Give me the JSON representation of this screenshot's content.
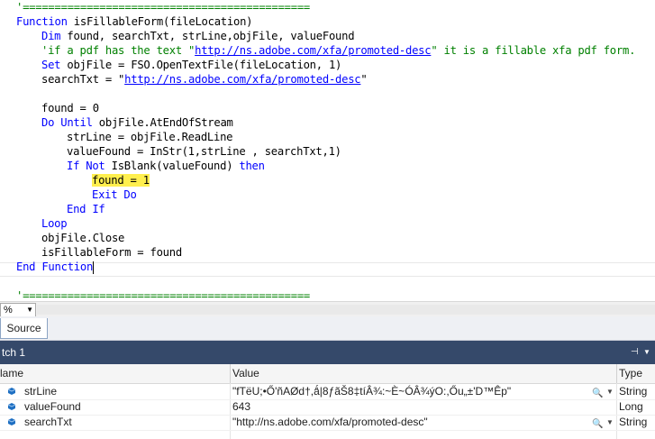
{
  "code": {
    "line1": "'=============================================",
    "line2_kw": "Function",
    "line2_rest": " isFillableForm(fileLocation)",
    "line3_kw": "Dim",
    "line3_rest": " found, searchTxt, strLine,objFile, valueFound",
    "line4_a": "'if a pdf has the text \"",
    "line4_link": "http://ns.adobe.com/xfa/promoted-desc",
    "line4_b": "\" it is a fillable xfa pdf form.",
    "line5_kw": "Set",
    "line5_rest": " objFile = FSO.OpenTextFile(fileLocation, 1)",
    "line6_a": "searchTxt = \"",
    "line6_link": "http://ns.adobe.com/xfa/promoted-desc",
    "line6_b": "\"",
    "line8": "found = 0",
    "line9_kw": "Do Until",
    "line9_rest": " objFile.AtEndOfStream",
    "line10": "strLine = objFile.ReadLine",
    "line11": "valueFound = InStr(1,strLine , searchTxt,1)",
    "line12_kw1": "If Not",
    "line12_mid": " IsBlank(valueFound) ",
    "line12_kw2": "then",
    "line13": "found = 1",
    "line14": "Exit Do",
    "line15": "End If",
    "line16": "Loop",
    "line17": "objFile.Close",
    "line18": "isFillableForm = found",
    "line19": "End Function",
    "line21": "'============================================="
  },
  "editor": {
    "zoom": "%"
  },
  "tabs": {
    "source": "Source"
  },
  "watch": {
    "title": "tch 1",
    "headers": {
      "name": "lame",
      "value": "Value",
      "type": "Type"
    },
    "rows": [
      {
        "name": "strLine",
        "value": "\"fTëU;•Ő'ñAØd†,ǻ|8ƒãŠ8‡tíÂ¾:~È~ÓÂ¾ýO:,Őu„±'D™Êp\"",
        "type": "String"
      },
      {
        "name": "valueFound",
        "value": "643",
        "type": "Long"
      },
      {
        "name": "searchTxt",
        "value": "\"http://ns.adobe.com/xfa/promoted-desc\"",
        "type": "String"
      }
    ]
  },
  "colors": {
    "keyword": "#0000ff",
    "comment": "#008000",
    "highlight": "#ffef4e",
    "watch_title_bg": "#35496a"
  }
}
